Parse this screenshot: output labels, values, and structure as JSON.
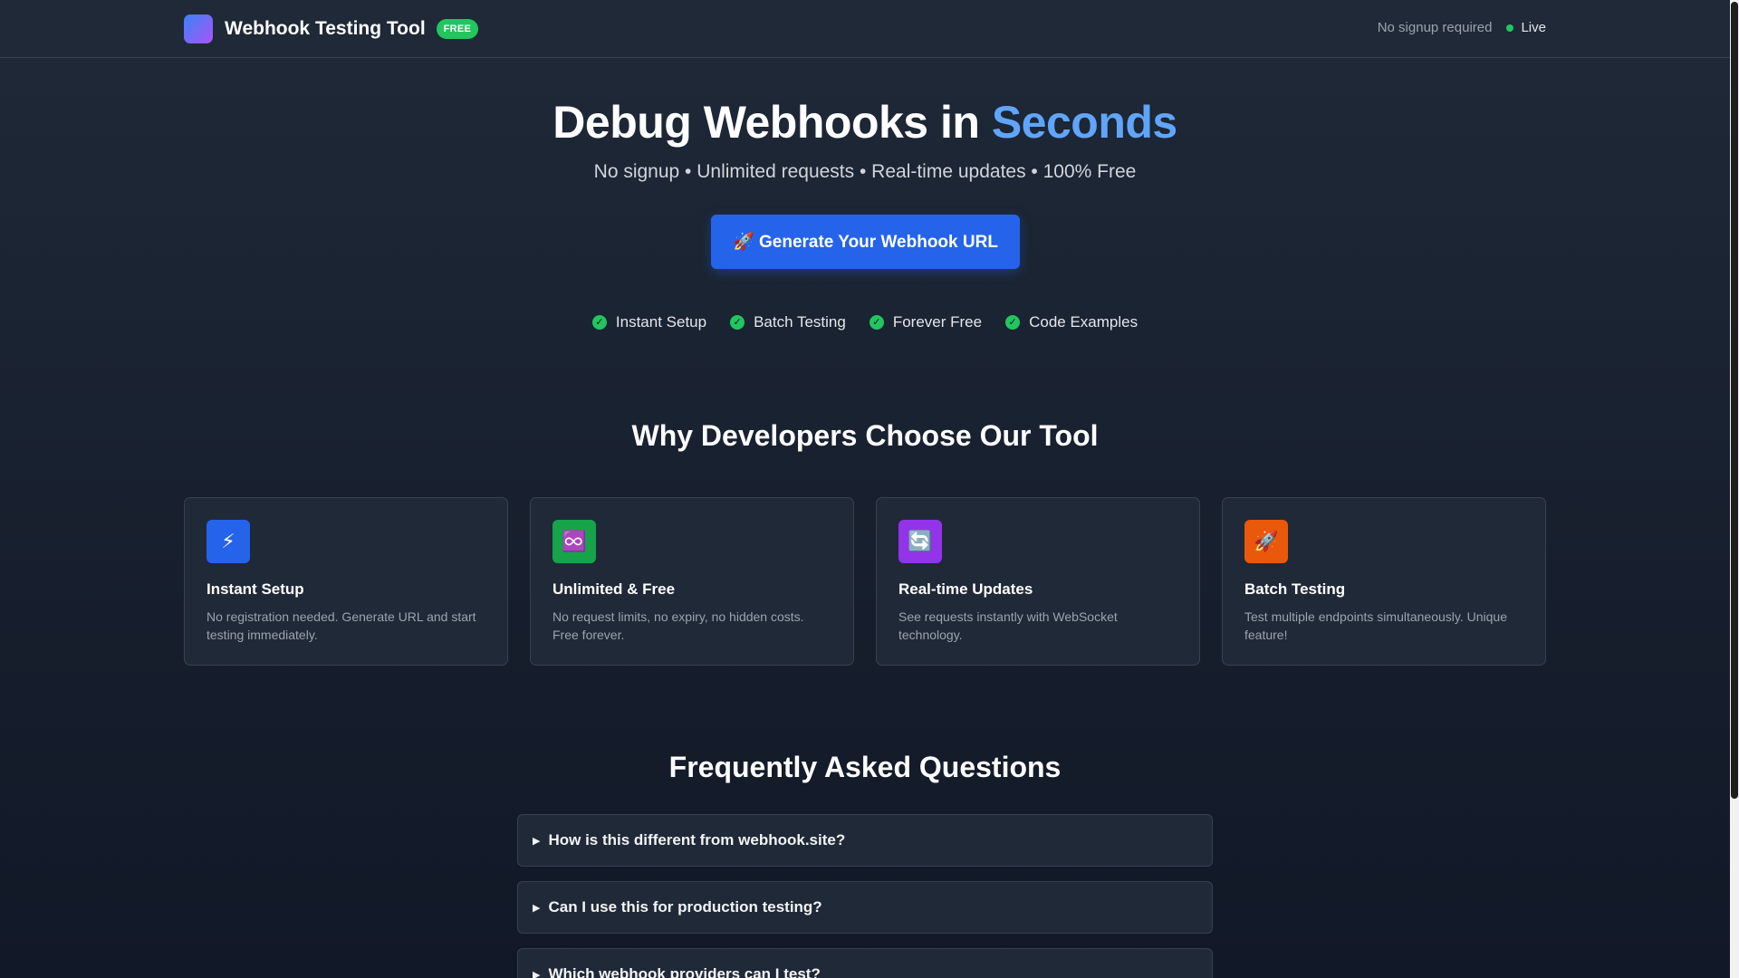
{
  "header": {
    "brand_name": "Webhook Testing Tool",
    "badge": "FREE",
    "no_signup": "No signup required",
    "live": "Live"
  },
  "hero": {
    "title_main": "Debug Webhooks in ",
    "title_accent": "Seconds",
    "subtitle": "No signup • Unlimited requests • Real-time updates • 100% Free",
    "cta_label": "🚀 Generate Your Webhook URL",
    "checks": [
      "Instant Setup",
      "Batch Testing",
      "Forever Free",
      "Code Examples"
    ]
  },
  "features": {
    "title": "Why Developers Choose Our Tool",
    "cards": [
      {
        "icon": "lightning-icon",
        "glyph": "⚡",
        "color": "#2563eb",
        "title": "Instant Setup",
        "desc": "No registration needed. Generate URL and start testing immediately."
      },
      {
        "icon": "infinity-icon",
        "glyph": "♾️",
        "color": "#16a34a",
        "title": "Unlimited & Free",
        "desc": "No request limits, no expiry, no hidden costs. Free forever."
      },
      {
        "icon": "refresh-icon",
        "glyph": "🔄",
        "color": "#9333ea",
        "title": "Real-time Updates",
        "desc": "See requests instantly with WebSocket technology."
      },
      {
        "icon": "rocket-icon",
        "glyph": "🚀",
        "color": "#ea580c",
        "title": "Batch Testing",
        "desc": "Test multiple endpoints simultaneously. Unique feature!"
      }
    ]
  },
  "faq": {
    "title": "Frequently Asked Questions",
    "items": [
      "How is this different from webhook.site?",
      "Can I use this for production testing?",
      "Which webhook providers can I test?"
    ]
  },
  "colors": {
    "accent": "#60a5fa",
    "primary_button": "#2563eb",
    "success": "#22c55e",
    "background": "#111827"
  }
}
